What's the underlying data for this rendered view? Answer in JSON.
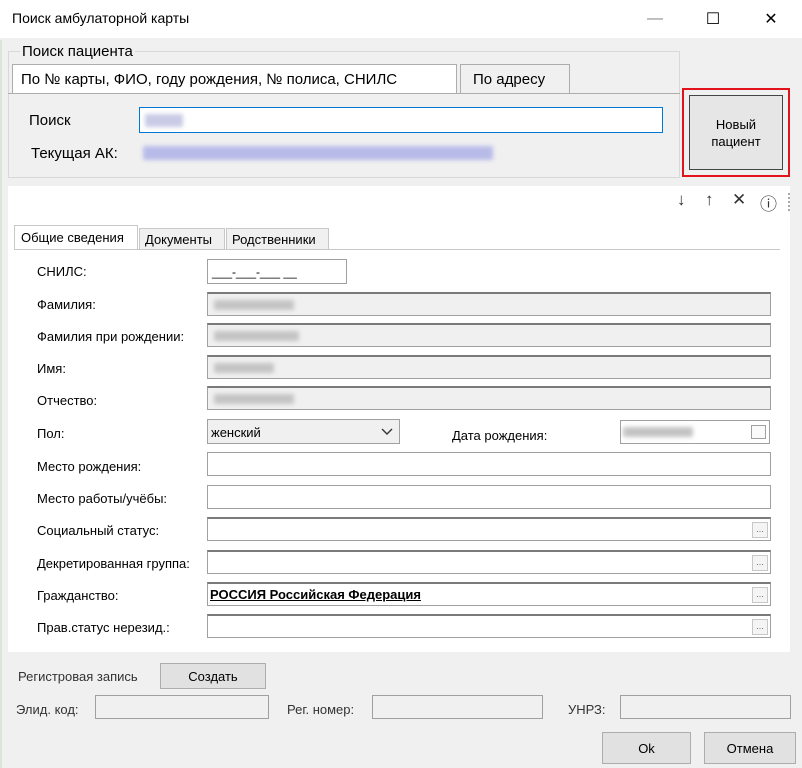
{
  "window": {
    "title": "Поиск амбулаторной карты",
    "controls": {
      "minimize": "—",
      "maximize": "☐",
      "close": "✕"
    }
  },
  "search_group": {
    "legend": "Поиск пациента",
    "tabs": [
      "По № карты, ФИО, году рождения, № полиса, СНИЛС",
      "По адресу"
    ],
    "search_label": "Поиск",
    "current_label": "Текущая АК:",
    "new_patient_button": {
      "line1": "Новый",
      "line2": "пациент"
    }
  },
  "toolbar": {
    "down": "↓",
    "up": "↑",
    "clear": "✕",
    "info": "ⓘ"
  },
  "form": {
    "tabs": [
      "Общие сведения",
      "Документы",
      "Родственники"
    ],
    "labels": {
      "snils": "СНИЛС:",
      "surname": "Фамилия:",
      "birth_surname": "Фамилия при рождении:",
      "name": "Имя:",
      "patronymic": "Отчество:",
      "gender": "Пол:",
      "birth_date": "Дата рождения:",
      "birth_place": "Место рождения:",
      "work_place": "Место работы/учёбы:",
      "social_status": "Социальный статус:",
      "decree_group": "Декретированная группа:",
      "citizenship": "Гражданство:",
      "legal_status": "Прав.статус нерезид.:"
    },
    "snils_mask": "___-___-___ __",
    "gender_value": "женский",
    "citizenship_value": "РОССИЯ Российская Федерация",
    "lookup_button": "..."
  },
  "bottom": {
    "reg_record_label": "Регистровая запись",
    "create_button": "Создать",
    "epid_label": "Элид. код:",
    "reg_number_label": "Рег. номер:",
    "unrz_label": "УНРЗ:",
    "ok_button": "Ok",
    "cancel_button": "Отмена"
  }
}
